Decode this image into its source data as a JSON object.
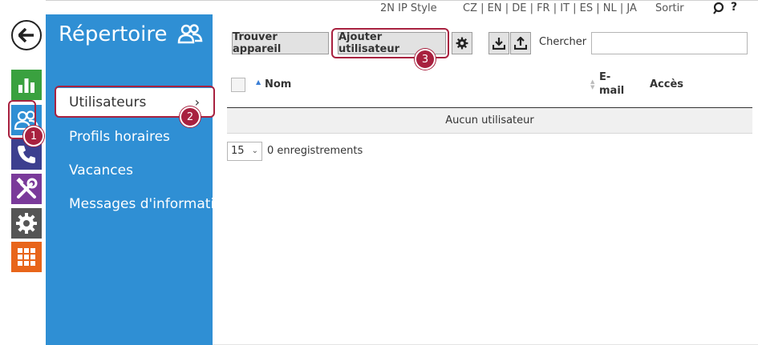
{
  "header": {
    "style_label": "2N IP Style",
    "languages": "CZ | EN | DE | FR | IT | ES | NL | JA",
    "exit_label": "Sortir",
    "help_label": "?"
  },
  "rail": {
    "icons": [
      "back-arrow-icon",
      "chart-icon",
      "users-icon",
      "phone-icon",
      "tools-icon",
      "gear-icon",
      "grid-icon"
    ]
  },
  "nav": {
    "title": "Répertoire",
    "items": [
      {
        "label": "Utilisateurs",
        "active": true
      },
      {
        "label": "Profils horaires"
      },
      {
        "label": "Vacances"
      },
      {
        "label": "Messages d'information"
      }
    ]
  },
  "toolbar": {
    "find_label": "Trouver appareil",
    "add_label": "Ajouter utilisateur",
    "search_label": "Chercher",
    "search_value": ""
  },
  "table": {
    "columns": [
      "Nom",
      "E-mail",
      "Accès"
    ],
    "empty_text": "Aucun utilisateur"
  },
  "pager": {
    "page_size": "15",
    "records_text": "0 enregistrements"
  },
  "annotations": [
    "1",
    "2",
    "3"
  ],
  "colors": {
    "nav_blue": "#2f8fd4",
    "highlight": "#a8213f",
    "green": "#3aa13f",
    "orange": "#e8651a"
  }
}
